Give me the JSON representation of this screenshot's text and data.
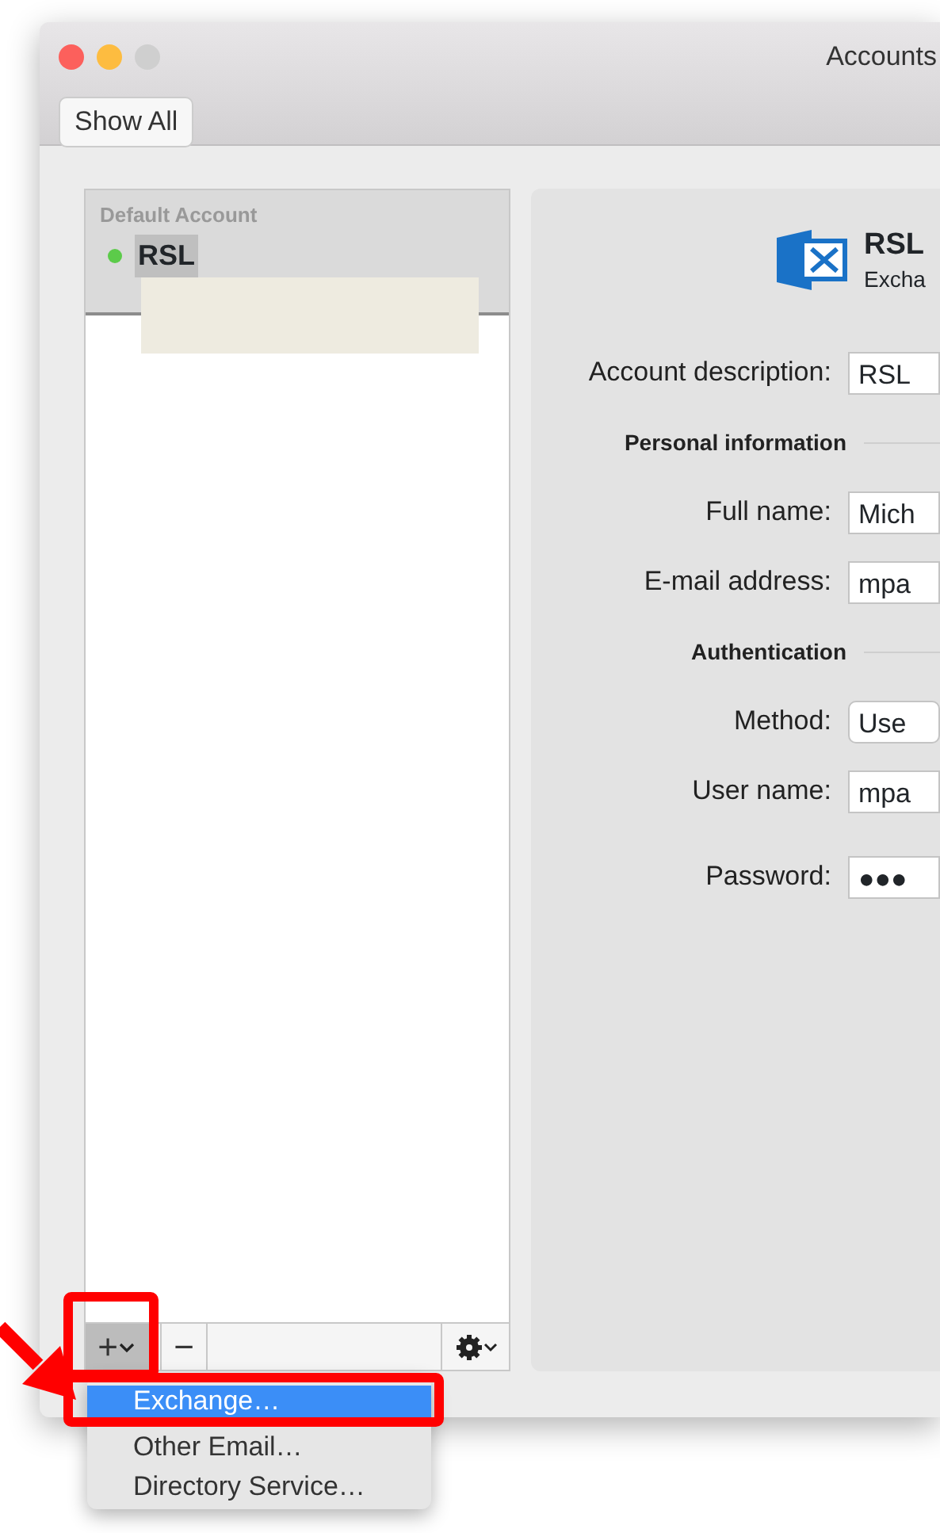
{
  "window": {
    "title": "Accounts",
    "show_all": "Show All"
  },
  "accounts_list": {
    "header": "Default Account",
    "accounts": [
      {
        "name": "RSL",
        "online": true,
        "selected": true
      }
    ],
    "add_button": "+",
    "remove_button": "−"
  },
  "account_header": {
    "name": "RSL",
    "type": "Excha"
  },
  "form": [
    {
      "kind": "field",
      "label": "Account description:",
      "value": "RSL"
    },
    {
      "kind": "section",
      "label": "Personal information"
    },
    {
      "kind": "field",
      "label": "Full name:",
      "value": "Mich"
    },
    {
      "kind": "field",
      "label": "E-mail address:",
      "value": "mpa"
    },
    {
      "kind": "section",
      "label": "Authentication"
    },
    {
      "kind": "popup",
      "label": "Method:",
      "value": "Use"
    },
    {
      "kind": "field",
      "label": "User name:",
      "value": "mpa"
    },
    {
      "kind": "password",
      "label": "Password:",
      "value": "●●●"
    }
  ],
  "add_menu": {
    "items": [
      {
        "label": "Exchange…",
        "selected": true
      },
      {
        "label": "Other Email…",
        "selected": false
      },
      {
        "label": "Directory Service…",
        "selected": false
      }
    ]
  }
}
